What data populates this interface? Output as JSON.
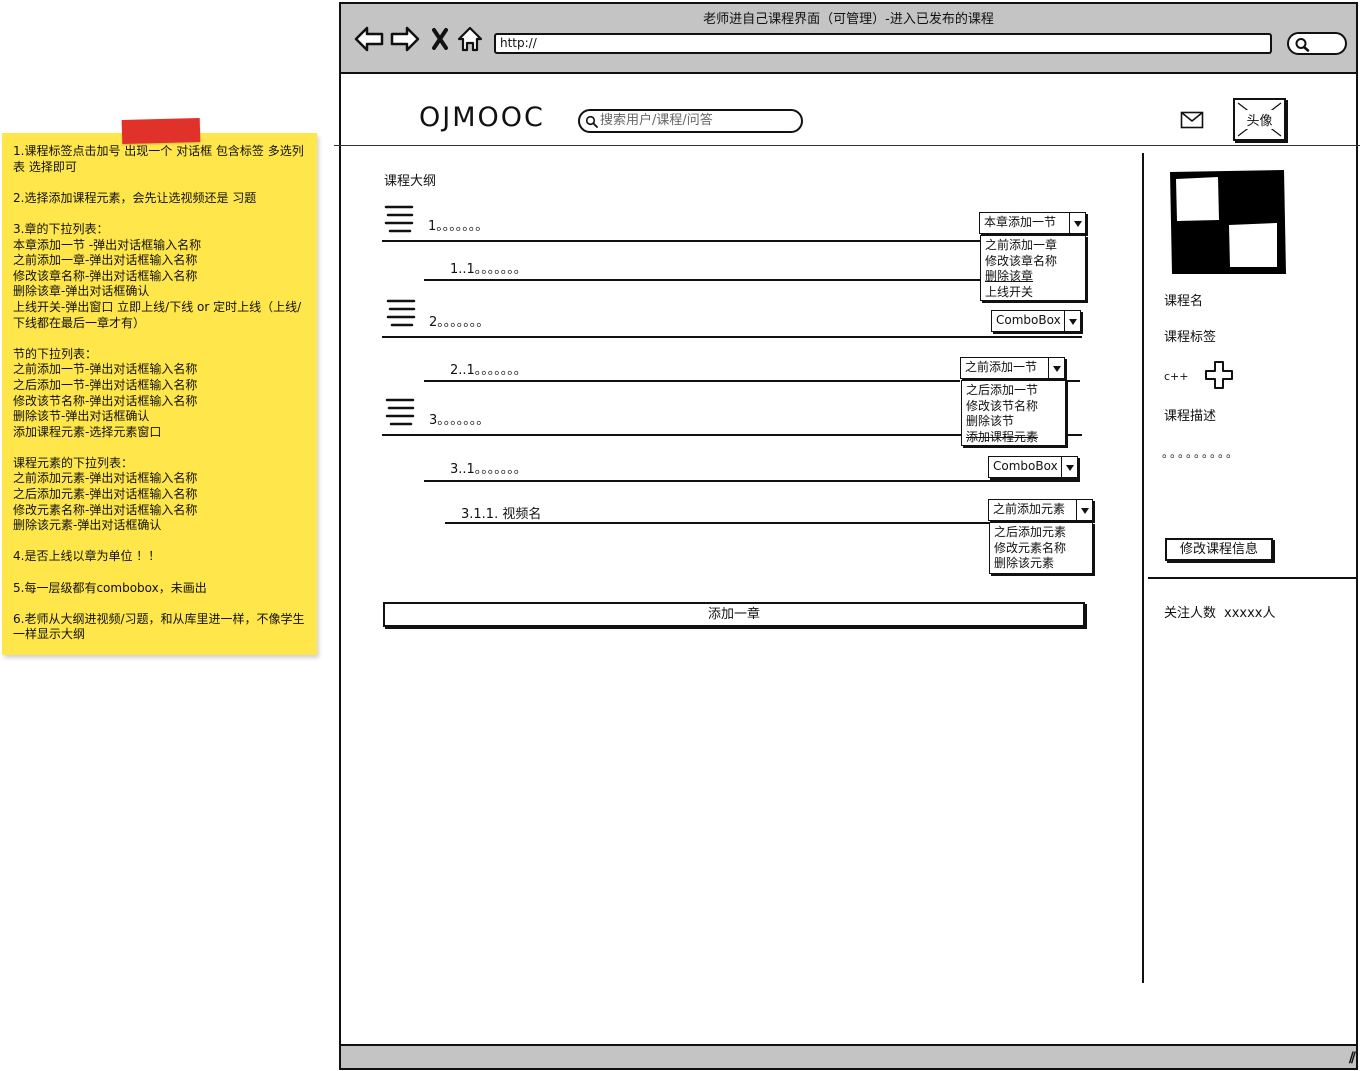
{
  "note": {
    "paragraphs": [
      "1.课程标签点击加号 出现一个 对话框 包含标签 多选列表 选择即可",
      "2.选择添加课程元素，会先让选视频还是 习题",
      "3.章的下拉列表：\n本章添加一节 -弹出对话框输入名称\n之前添加一章-弹出对话框输入名称\n修改该章名称-弹出对话框输入名称\n删除该章-弹出对话框确认\n上线开关-弹出窗口 立即上线/下线 or 定时上线（上线/下线都在最后一章才有）",
      "节的下拉列表：\n之前添加一节-弹出对话框输入名称\n之后添加一节-弹出对话框输入名称\n修改该节名称-弹出对话框输入名称\n删除该节-弹出对话框确认\n添加课程元素-选择元素窗口",
      "课程元素的下拉列表：\n之前添加元素-弹出对话框输入名称\n之后添加元素-弹出对话框输入名称\n修改元素名称-弹出对话框输入名称\n删除该元素-弹出对话框确认",
      "4.是否上线以章为单位 ！！",
      "5.每一层级都有combobox，未画出",
      "6.老师从大纲进视频/习题，和从库里进一样，不像学生一样显示大纲"
    ]
  },
  "browser": {
    "title": "老师进自己课程界面（可管理）-进入已发布的课程",
    "url": "http://"
  },
  "header": {
    "logo": "OJMOOC",
    "search_placeholder": "搜索用户/课程/问答",
    "avatar_label": "头像"
  },
  "outline": {
    "title": "课程大纲",
    "rows": [
      {
        "label": "1。。。。。。。"
      },
      {
        "label": "1..1。。。。。。。"
      },
      {
        "label": "2。。。。。。。"
      },
      {
        "label": "2..1。。。。。。。"
      },
      {
        "label": "3。。。。。。。"
      },
      {
        "label": "3..1。。。。。。。"
      },
      {
        "label": "3.1.1. 视频名"
      }
    ],
    "chapter_combo": {
      "selected": "本章添加一节",
      "options": [
        "之前添加一章",
        "修改该章名称",
        "删除该章",
        "上线开关"
      ]
    },
    "section_combo": {
      "selected": "之前添加一节",
      "options": [
        "之后添加一节",
        "修改该节名称",
        "删除该节",
        "添加课程元素"
      ]
    },
    "element_combo": {
      "selected": "之前添加元素",
      "options": [
        "之后添加元素",
        "修改元素名称",
        "删除该元素"
      ]
    },
    "combobox_label": "ComboBox",
    "add_chapter": "添加一章"
  },
  "sidebar": {
    "course_name": "课程名",
    "course_tags": "课程标签",
    "tag": "c++",
    "course_desc": "课程描述",
    "desc_text": "。。。。。。。。。",
    "edit_button": "修改课程信息",
    "followers_label": "关注人数",
    "followers_value": "xxxxx人"
  }
}
